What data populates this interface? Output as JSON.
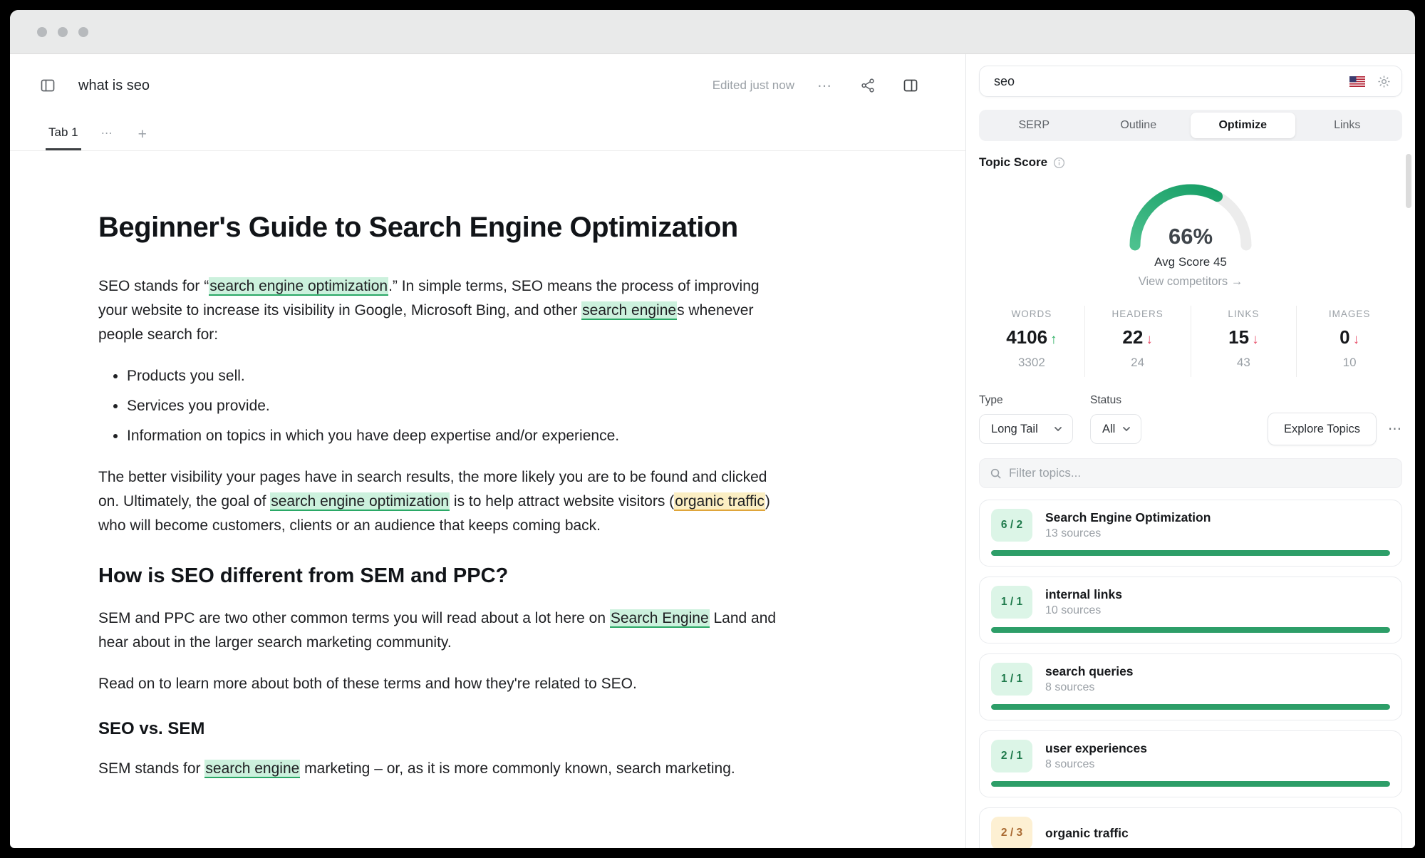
{
  "editor": {
    "header": {
      "title": "what is seo",
      "edited": "Edited just now",
      "more": "⋯"
    },
    "tabbar": {
      "active_tab": "Tab 1",
      "more": "⋯",
      "add": "+"
    },
    "document": {
      "blocks": [
        {
          "type": "h1",
          "segments": [
            {
              "t": "Beginner's Guide to Search Engine Optimization"
            }
          ]
        },
        {
          "type": "p",
          "segments": [
            {
              "t": "SEO stands for “"
            },
            {
              "t": "search engine optimization",
              "h": "green"
            },
            {
              "t": ".” In simple terms, SEO means the process of improving your website to increase its visibility in Google, Microsoft Bing, and other "
            },
            {
              "t": "search engine",
              "h": "green"
            },
            {
              "t": "s whenever people search for:"
            }
          ]
        },
        {
          "type": "ul",
          "items": [
            "Products you sell.",
            "Services you provide.",
            "Information on topics in which you have deep expertise and/or experience."
          ]
        },
        {
          "type": "p",
          "segments": [
            {
              "t": "The better visibility your pages have in search results, the more likely you are to be found and clicked on. Ultimately, the goal of "
            },
            {
              "t": "search engine optimization",
              "h": "green"
            },
            {
              "t": " is to help attract website visitors ("
            },
            {
              "t": "organic traffic",
              "h": "yellow"
            },
            {
              "t": ") who will become customers, clients or an audience that keeps coming back."
            }
          ]
        },
        {
          "type": "h2",
          "segments": [
            {
              "t": "How is SEO different from SEM and PPC?"
            }
          ]
        },
        {
          "type": "p",
          "segments": [
            {
              "t": "SEM and PPC are two other common terms you will read about a lot here on "
            },
            {
              "t": "Search Engine",
              "h": "green"
            },
            {
              "t": " Land and hear about in the larger search marketing community."
            }
          ]
        },
        {
          "type": "p",
          "segments": [
            {
              "t": "Read on to learn more about both of these terms and how they're related to SEO."
            }
          ]
        },
        {
          "type": "h3",
          "segments": [
            {
              "t": "SEO vs. SEM"
            }
          ]
        },
        {
          "type": "p",
          "segments": [
            {
              "t": "SEM stands for "
            },
            {
              "t": "search engine",
              "h": "green"
            },
            {
              "t": " marketing – or, as it is more commonly known, search marketing."
            }
          ]
        }
      ]
    }
  },
  "panel": {
    "search": {
      "value": "seo"
    },
    "tabs": [
      {
        "label": "SERP",
        "active": false
      },
      {
        "label": "Outline",
        "active": false
      },
      {
        "label": "Optimize",
        "active": true
      },
      {
        "label": "Links",
        "active": false
      }
    ],
    "topic_score": {
      "label": "Topic Score",
      "percent": 66,
      "display": "66%",
      "avg": "Avg Score 45",
      "competitors": "View competitors",
      "arrow": "→"
    },
    "stats": [
      {
        "label": "WORDS",
        "value": "4106",
        "trend": "up",
        "target": "3302"
      },
      {
        "label": "HEADERS",
        "value": "22",
        "trend": "down",
        "target": "24"
      },
      {
        "label": "LINKS",
        "value": "15",
        "trend": "down",
        "target": "43"
      },
      {
        "label": "IMAGES",
        "value": "0",
        "trend": "down",
        "target": "10"
      }
    ],
    "filters": {
      "type_label": "Type",
      "type_value": "Long Tail",
      "status_label": "Status",
      "status_value": "All",
      "explore": "Explore Topics",
      "more": "⋯"
    },
    "filter_placeholder": "Filter topics...",
    "topics": [
      {
        "badge": "6 / 2",
        "title": "Search Engine Optimization",
        "sources": "13 sources",
        "progress": 100,
        "tone": "green"
      },
      {
        "badge": "1 / 1",
        "title": "internal links",
        "sources": "10 sources",
        "progress": 100,
        "tone": "green"
      },
      {
        "badge": "1 / 1",
        "title": "search queries",
        "sources": "8 sources",
        "progress": 100,
        "tone": "green"
      },
      {
        "badge": "2 / 1",
        "title": "user experiences",
        "sources": "8 sources",
        "progress": 100,
        "tone": "green"
      },
      {
        "badge": "2 / 3",
        "title": "organic traffic",
        "sources": "",
        "progress": null,
        "tone": "orange"
      }
    ],
    "colors": {
      "accent_green": "#2d9e68",
      "gauge_start": "#4cc18e",
      "gauge_end": "#0f9960",
      "gauge_track": "#ececec",
      "badge_green_bg": "#dcf5e7",
      "badge_green_text": "#1e7a4b",
      "badge_orange_bg": "#fdf0d3",
      "badge_orange_text": "#a96a32",
      "trend_up": "#27ae60",
      "trend_down": "#e8506b"
    }
  }
}
